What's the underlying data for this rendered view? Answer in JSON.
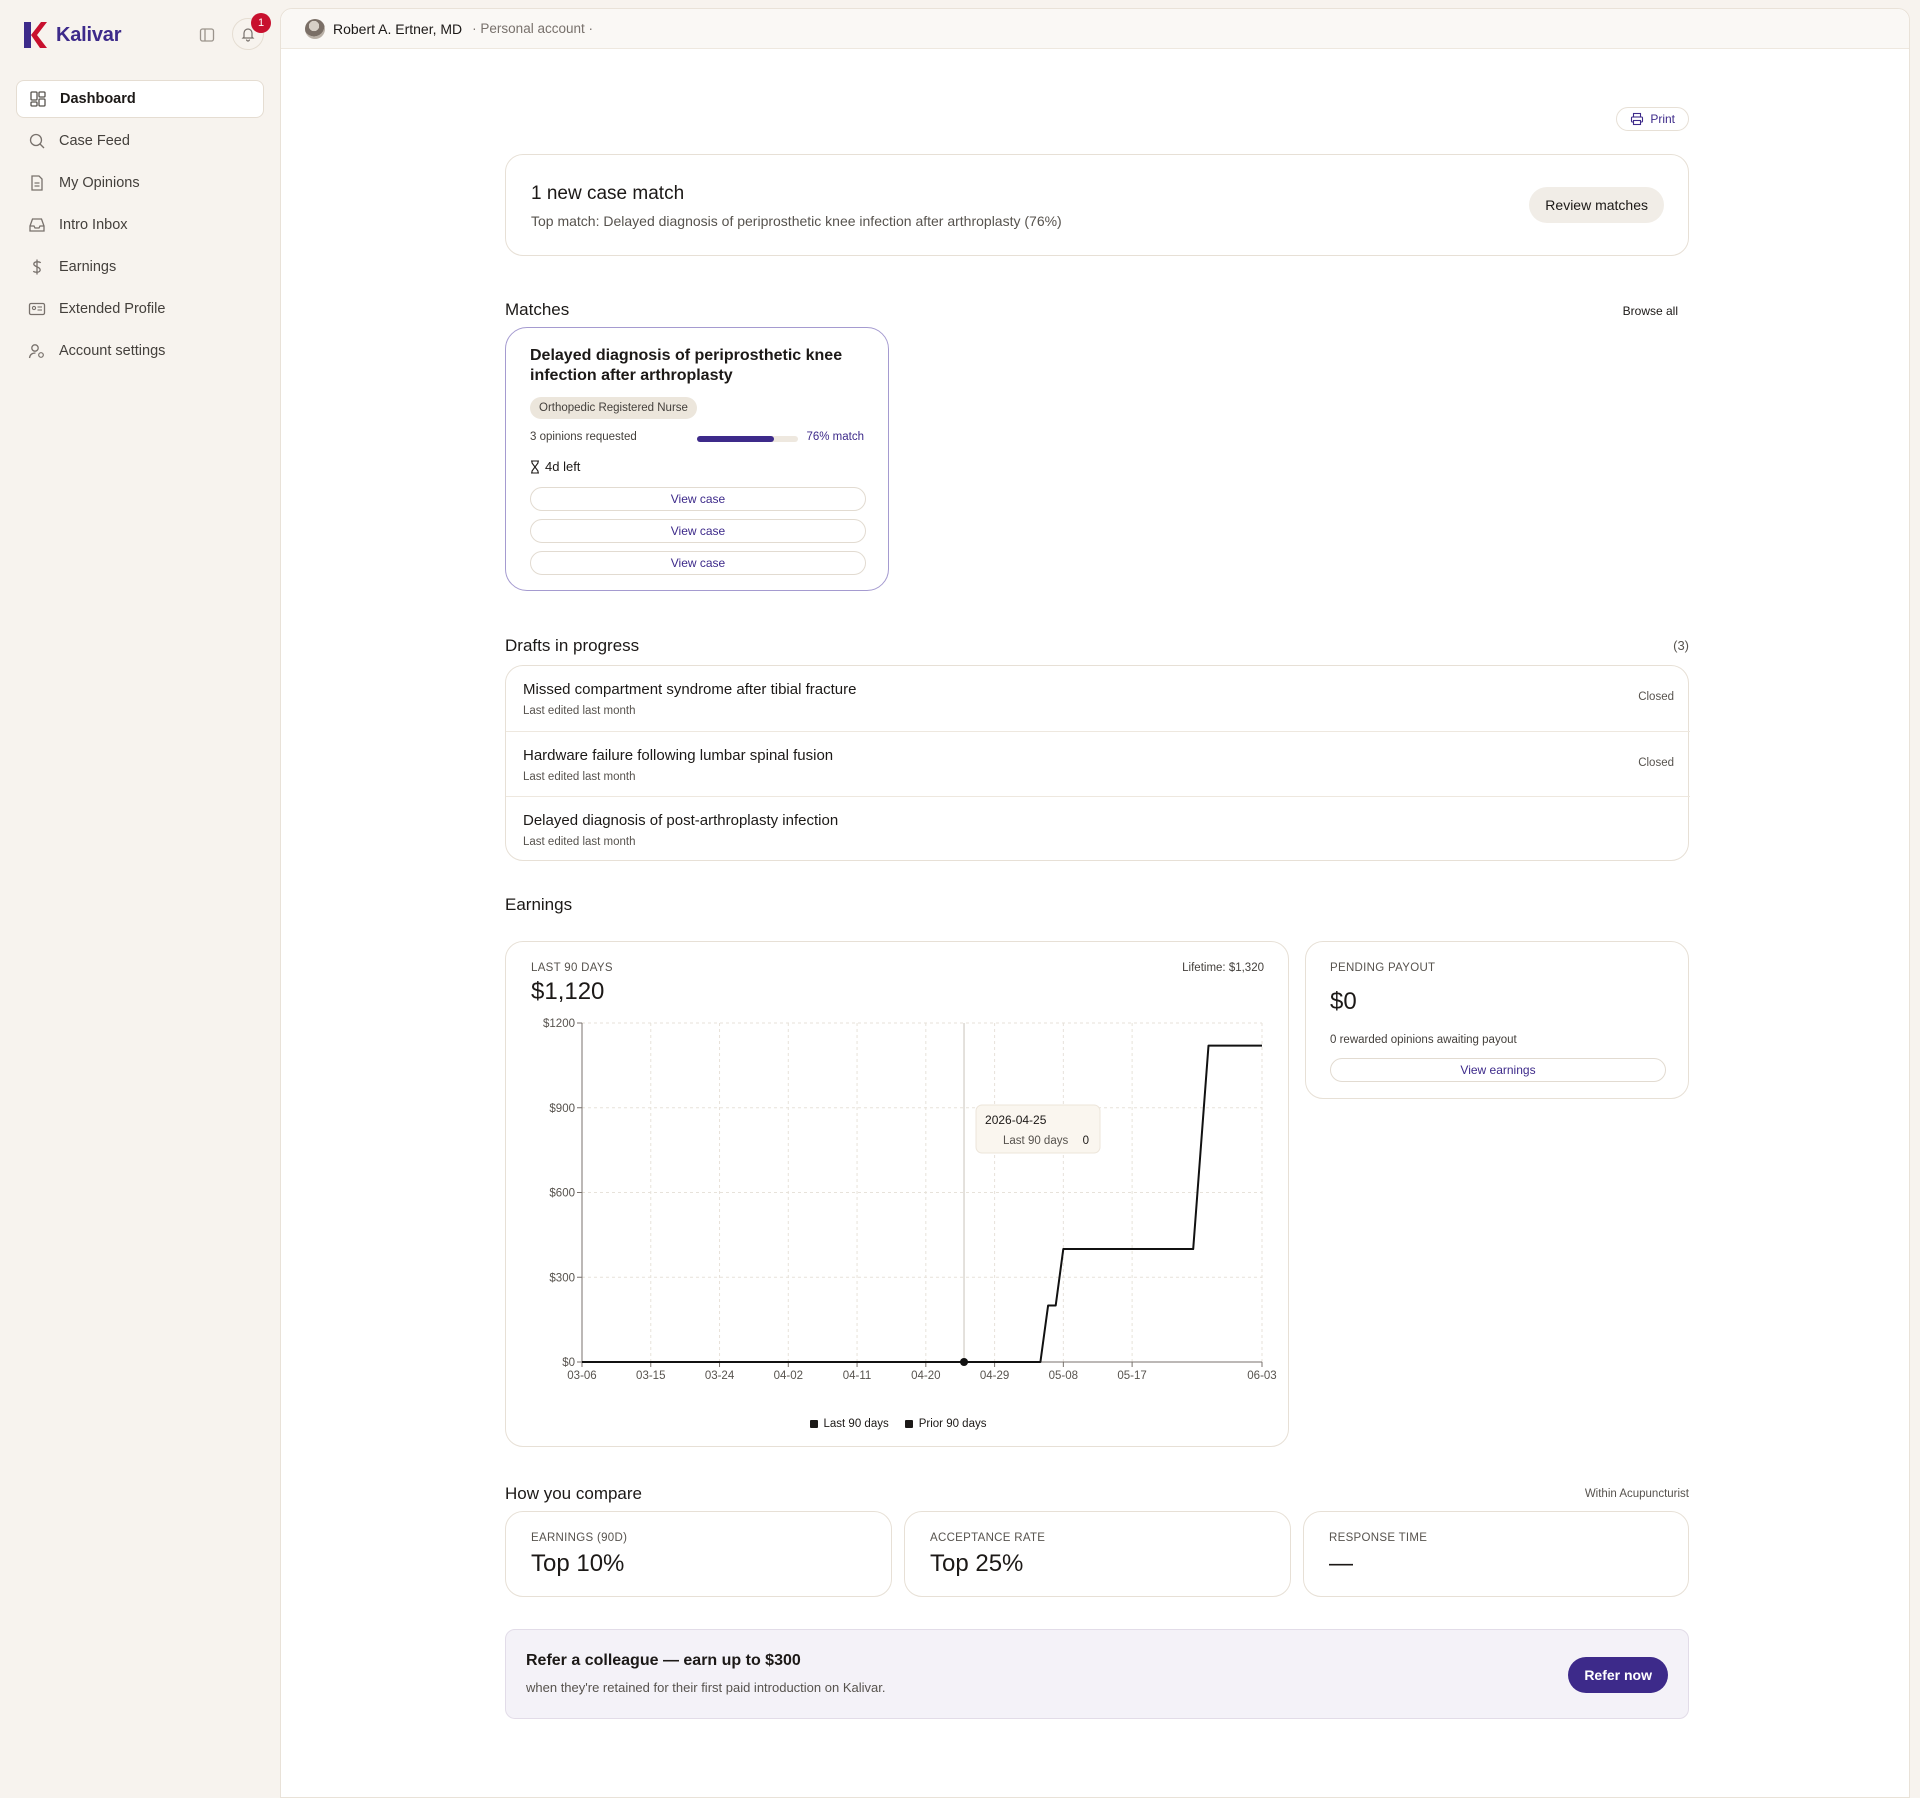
{
  "app": {
    "name": "Kalivar",
    "notifications": "1"
  },
  "sidebar": {
    "items": [
      {
        "label": "Dashboard",
        "icon": "dashboard-icon"
      },
      {
        "label": "Case Feed",
        "icon": "search-icon"
      },
      {
        "label": "My Opinions",
        "icon": "document-icon"
      },
      {
        "label": "Intro Inbox",
        "icon": "inbox-icon"
      },
      {
        "label": "Earnings",
        "icon": "dollar-icon"
      },
      {
        "label": "Extended Profile",
        "icon": "id-card-icon"
      },
      {
        "label": "Account settings",
        "icon": "user-gear-icon"
      }
    ]
  },
  "topbar": {
    "user_name": "Robert A. Ertner, MD",
    "account_type": "· Personal account ·"
  },
  "toolbar": {
    "print_label": "Print"
  },
  "alert": {
    "title": "1 new case match",
    "subtitle": "Top match: Delayed diagnosis of periprosthetic knee infection after arthroplasty (76%)",
    "button": "Review matches"
  },
  "matches": {
    "title": "Matches",
    "browse_all": "Browse all",
    "card": {
      "title": "Delayed diagnosis of periprosthetic knee infection after arthroplasty",
      "tag": "Orthopedic Registered Nurse",
      "opinions": "3 opinions requested",
      "match_fraction": 0.76,
      "match_label": "76% match",
      "time_left": "4d left",
      "view_case": "View case"
    }
  },
  "drafts": {
    "title": "Drafts in progress",
    "count": "(3)",
    "items": [
      {
        "title": "Missed compartment syndrome after tibial fracture",
        "sub": "Last edited last month",
        "status": "Closed"
      },
      {
        "title": "Hardware failure following lumbar spinal fusion",
        "sub": "Last edited last month",
        "status": "Closed"
      },
      {
        "title": "Delayed diagnosis of post-arthroplasty infection",
        "sub": "Last edited last month",
        "status": ""
      }
    ]
  },
  "earnings": {
    "title": "Earnings",
    "eyebrow": "LAST 90 DAYS",
    "lifetime": "Lifetime: $1,320",
    "value": "$1,120",
    "legend": [
      "Last 90 days",
      "Prior 90 days"
    ],
    "tooltip": {
      "date": "2026-04-25",
      "series": "Last 90 days",
      "value": "0"
    },
    "payout": {
      "eyebrow": "PENDING PAYOUT",
      "value": "$0",
      "sub": "0 rewarded opinions awaiting payout",
      "button": "View earnings"
    }
  },
  "chart_data": {
    "type": "line",
    "x_tick_labels": [
      "03-06",
      "03-15",
      "03-24",
      "04-02",
      "04-11",
      "04-20",
      "04-29",
      "05-08",
      "05-17",
      "06-03"
    ],
    "y_tick_labels": [
      "$0",
      "$300",
      "$600",
      "$900",
      "$1200"
    ],
    "ylim": [
      0,
      1200
    ],
    "grid": true,
    "legend_placement": "bottom",
    "series": [
      {
        "name": "Last 90 days",
        "color": "#111111",
        "points": [
          [
            "03-06",
            0
          ],
          [
            "04-25",
            0
          ],
          [
            "05-05",
            0
          ],
          [
            "05-06",
            200
          ],
          [
            "05-07",
            200
          ],
          [
            "05-08",
            400
          ],
          [
            "05-25",
            400
          ],
          [
            "05-27",
            1120
          ],
          [
            "06-03",
            1120
          ]
        ]
      },
      {
        "name": "Prior 90 days",
        "color": "#111111",
        "points": []
      }
    ],
    "highlight": {
      "x": "04-25",
      "value": 0
    }
  },
  "compare": {
    "title": "How you compare",
    "aside": "Within Acupuncturist",
    "cards": [
      {
        "label": "EARNINGS (90D)",
        "value": "Top 10%"
      },
      {
        "label": "ACCEPTANCE RATE",
        "value": "Top 25%"
      },
      {
        "label": "RESPONSE TIME",
        "value": "—"
      }
    ]
  },
  "refer": {
    "title": "Refer a colleague — earn up to $300",
    "sub": "when they're retained for their first paid introduction on Kalivar.",
    "button": "Refer now"
  },
  "colors": {
    "accent": "#3d2a8a",
    "brand_red": "#c8102e",
    "sidebar_bg": "#f7f3ee"
  }
}
